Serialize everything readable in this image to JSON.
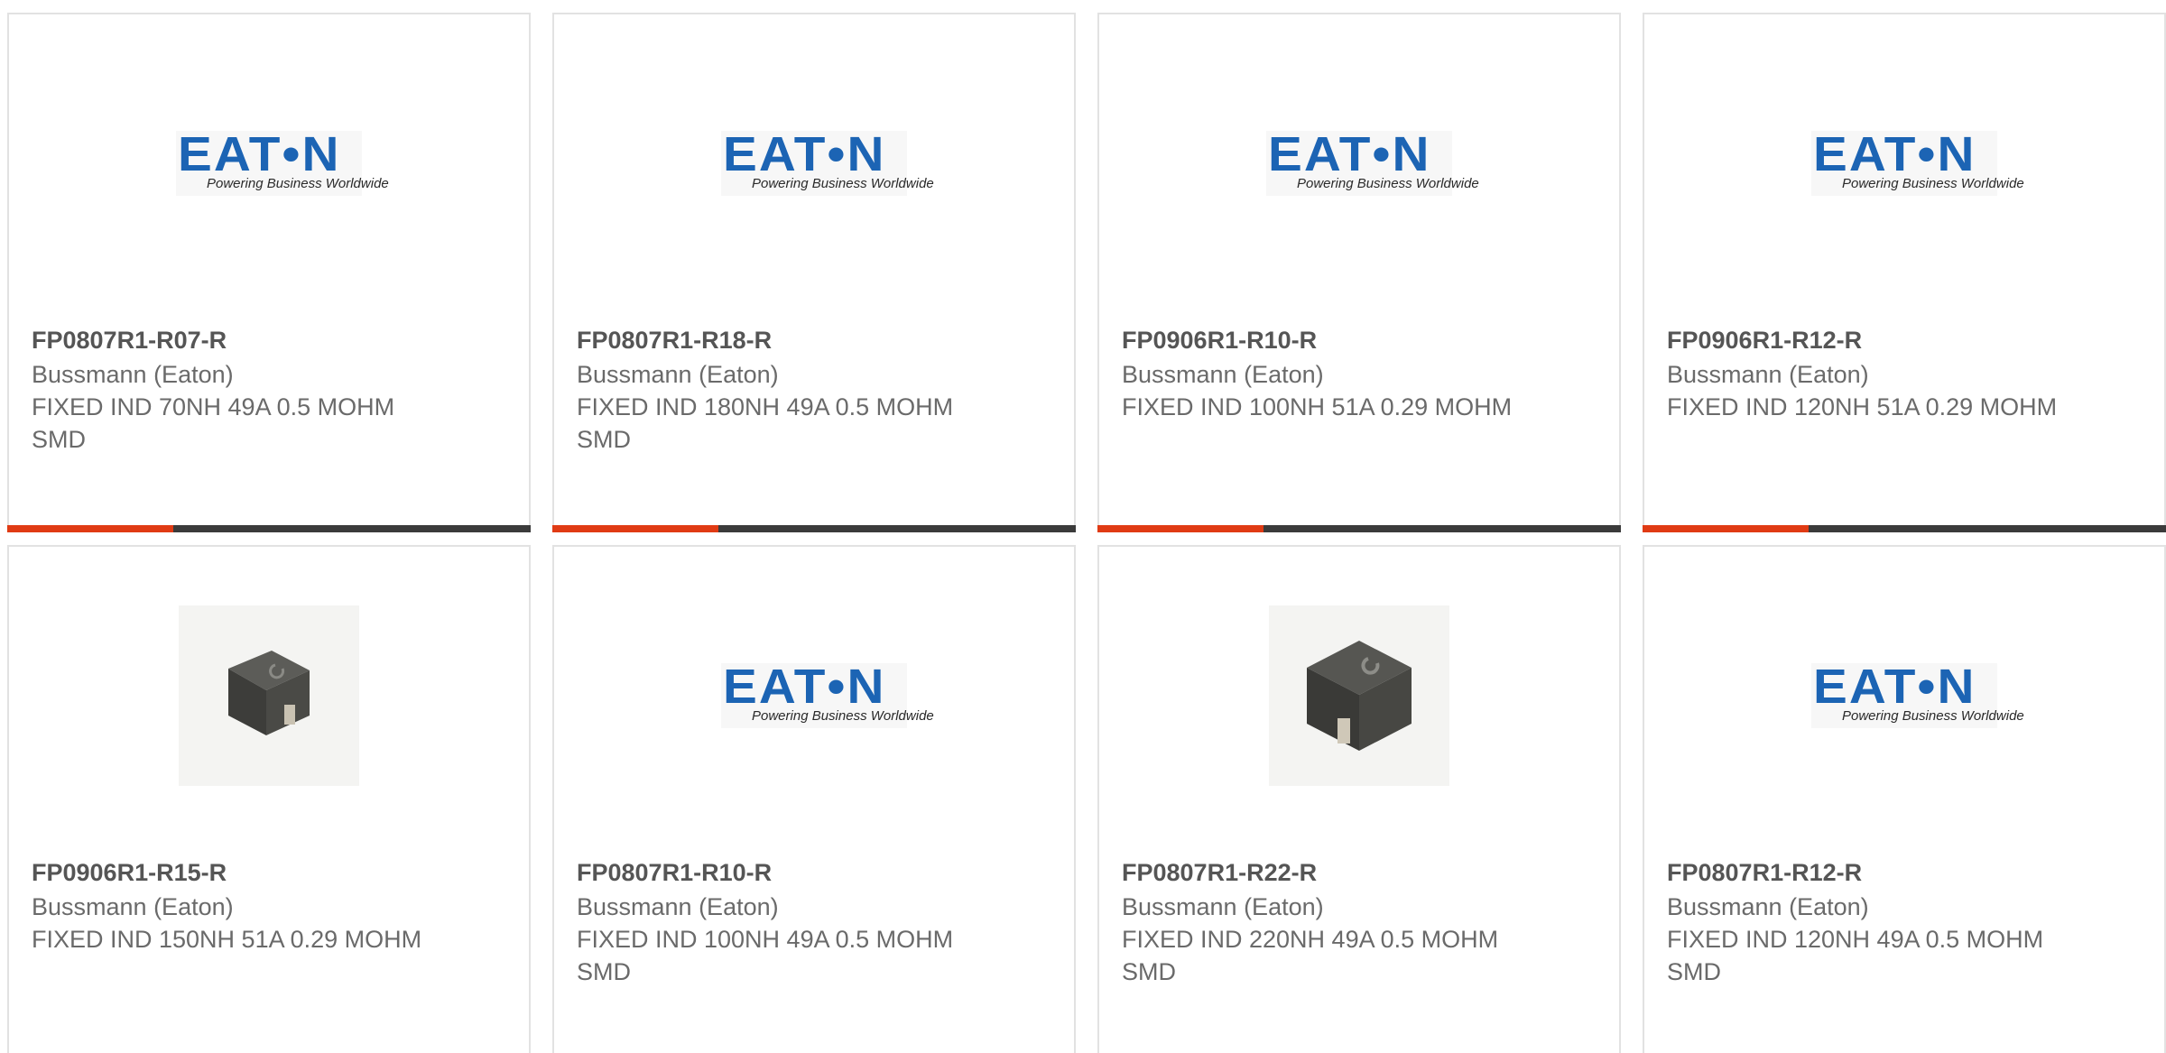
{
  "colors": {
    "accent": "#e03b14",
    "bar_track": "#3b3b3b",
    "brand_blue": "#1c64b4"
  },
  "products": [
    {
      "part_number": "FP0807R1-R07-R",
      "manufacturer": "Bussmann (Eaton)",
      "description": "FIXED IND 70NH 49A 0.5 MOHM SMD",
      "image": "eaton-logo",
      "logo_word": "EAT•N",
      "logo_tagline": "Powering Business Worldwide"
    },
    {
      "part_number": "FP0807R1-R18-R",
      "manufacturer": "Bussmann (Eaton)",
      "description": "FIXED IND 180NH 49A 0.5 MOHM SMD",
      "image": "eaton-logo",
      "logo_word": "EAT•N",
      "logo_tagline": "Powering Business Worldwide"
    },
    {
      "part_number": "FP0906R1-R10-R",
      "manufacturer": "Bussmann (Eaton)",
      "description": "FIXED IND 100NH 51A 0.29 MOHM",
      "image": "eaton-logo",
      "logo_word": "EAT•N",
      "logo_tagline": "Powering Business Worldwide"
    },
    {
      "part_number": "FP0906R1-R12-R",
      "manufacturer": "Bussmann (Eaton)",
      "description": "FIXED IND 120NH 51A 0.29 MOHM",
      "image": "eaton-logo",
      "logo_word": "EAT•N",
      "logo_tagline": "Powering Business Worldwide"
    },
    {
      "part_number": "FP0906R1-R15-R",
      "manufacturer": "Bussmann (Eaton)",
      "description": "FIXED IND 150NH 51A 0.29 MOHM",
      "image": "inductor-photo-small"
    },
    {
      "part_number": "FP0807R1-R10-R",
      "manufacturer": "Bussmann (Eaton)",
      "description": "FIXED IND 100NH 49A 0.5 MOHM SMD",
      "image": "eaton-logo",
      "logo_word": "EAT•N",
      "logo_tagline": "Powering Business Worldwide"
    },
    {
      "part_number": "FP0807R1-R22-R",
      "manufacturer": "Bussmann (Eaton)",
      "description": "FIXED IND 220NH 49A 0.5 MOHM SMD",
      "image": "inductor-photo-large"
    },
    {
      "part_number": "FP0807R1-R12-R",
      "manufacturer": "Bussmann (Eaton)",
      "description": "FIXED IND 120NH 49A 0.5 MOHM SMD",
      "image": "eaton-logo",
      "logo_word": "EAT•N",
      "logo_tagline": "Powering Business Worldwide"
    }
  ]
}
